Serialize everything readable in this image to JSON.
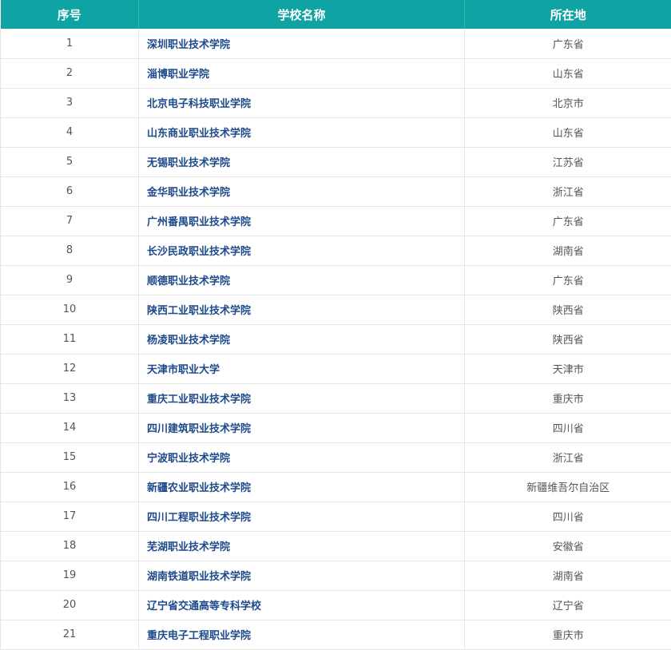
{
  "header": {
    "col_index": "序号",
    "col_school": "学校名称",
    "col_location": "所在地"
  },
  "rows": [
    {
      "index": "1",
      "school": "深圳职业技术学院",
      "location": "广东省"
    },
    {
      "index": "2",
      "school": "淄博职业学院",
      "location": "山东省"
    },
    {
      "index": "3",
      "school": "北京电子科技职业学院",
      "location": "北京市"
    },
    {
      "index": "4",
      "school": "山东商业职业技术学院",
      "location": "山东省"
    },
    {
      "index": "5",
      "school": "无锡职业技术学院",
      "location": "江苏省"
    },
    {
      "index": "6",
      "school": "金华职业技术学院",
      "location": "浙江省"
    },
    {
      "index": "7",
      "school": "广州番禺职业技术学院",
      "location": "广东省"
    },
    {
      "index": "8",
      "school": "长沙民政职业技术学院",
      "location": "湖南省"
    },
    {
      "index": "9",
      "school": "顺德职业技术学院",
      "location": "广东省"
    },
    {
      "index": "10",
      "school": "陕西工业职业技术学院",
      "location": "陕西省"
    },
    {
      "index": "11",
      "school": "杨凌职业技术学院",
      "location": "陕西省"
    },
    {
      "index": "12",
      "school": "天津市职业大学",
      "location": "天津市"
    },
    {
      "index": "13",
      "school": "重庆工业职业技术学院",
      "location": "重庆市"
    },
    {
      "index": "14",
      "school": "四川建筑职业技术学院",
      "location": "四川省"
    },
    {
      "index": "15",
      "school": "宁波职业技术学院",
      "location": "浙江省"
    },
    {
      "index": "16",
      "school": "新疆农业职业技术学院",
      "location": "新疆维吾尔自治区"
    },
    {
      "index": "17",
      "school": "四川工程职业技术学院",
      "location": "四川省"
    },
    {
      "index": "18",
      "school": "芜湖职业技术学院",
      "location": "安徽省"
    },
    {
      "index": "19",
      "school": "湖南铁道职业技术学院",
      "location": "湖南省"
    },
    {
      "index": "20",
      "school": "辽宁省交通高等专科学校",
      "location": "辽宁省"
    },
    {
      "index": "21",
      "school": "重庆电子工程职业学院",
      "location": "重庆市"
    }
  ],
  "colors": {
    "header_bg": "#0fa3a3",
    "school_text": "#1d4a8a",
    "body_text": "#555555"
  }
}
